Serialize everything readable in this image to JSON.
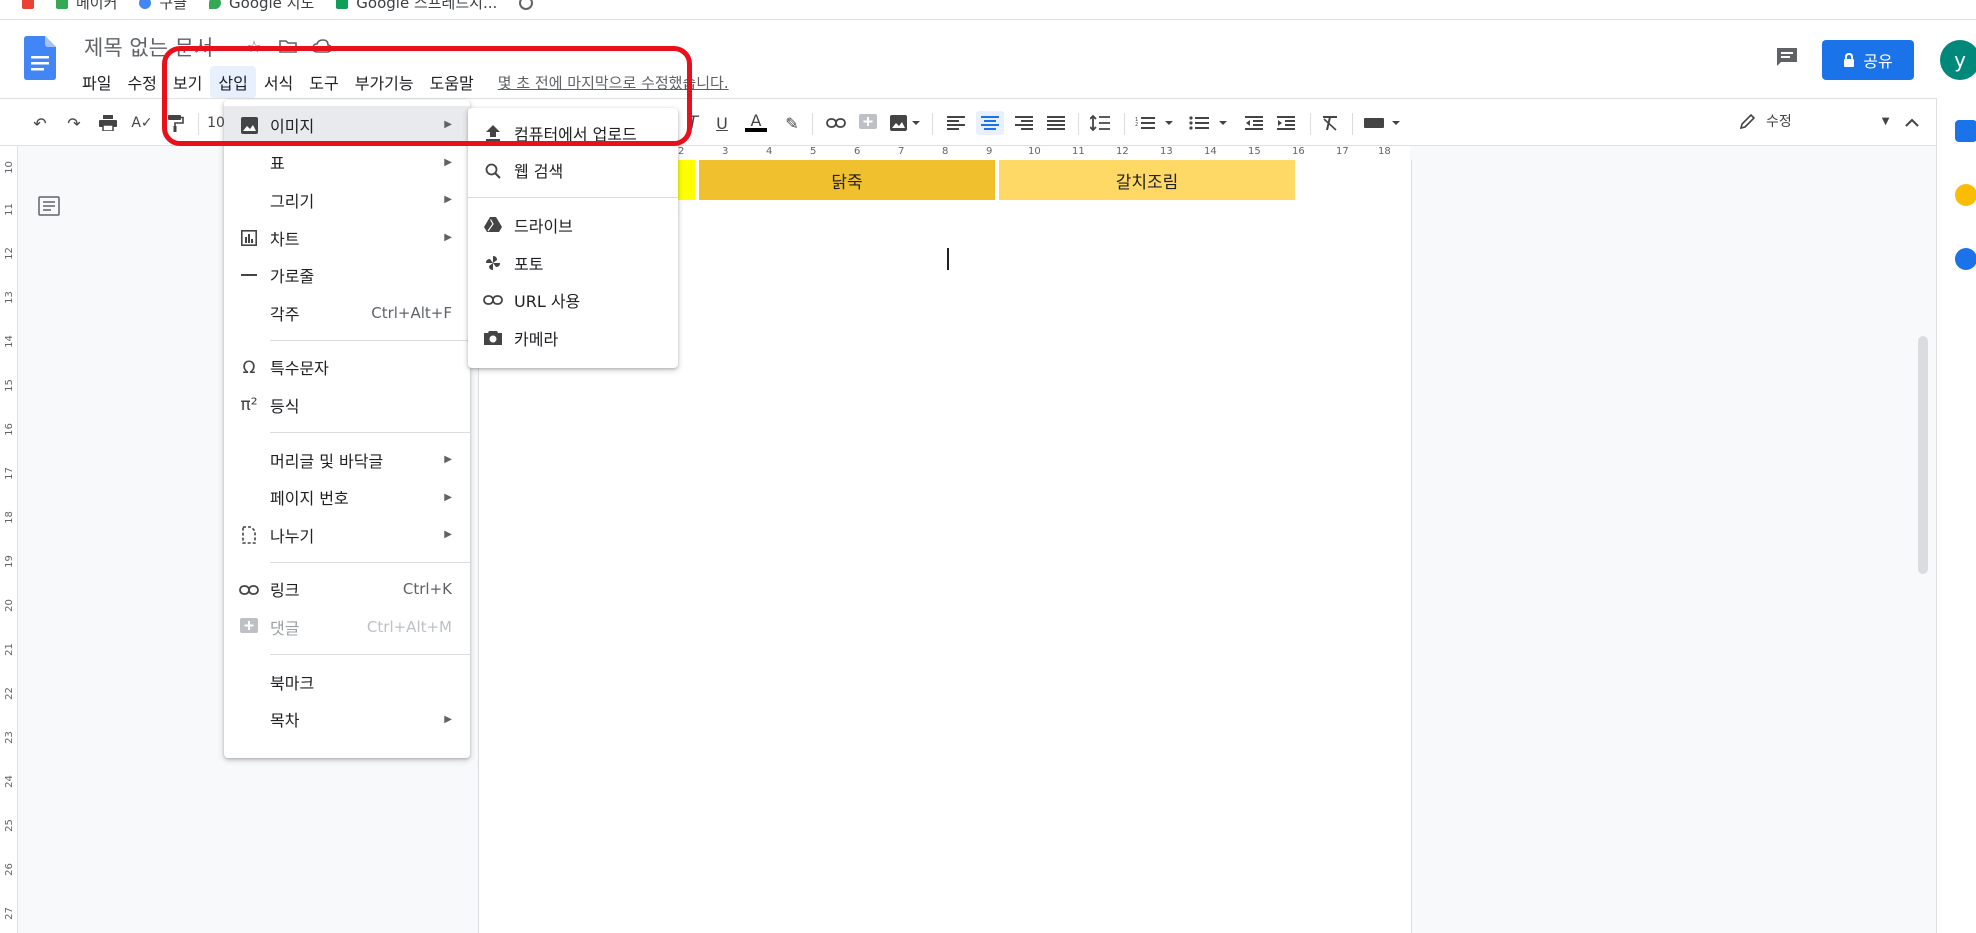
{
  "document": {
    "title": "제목 없는 문서",
    "last_edit": "몇 초 전에 마지막으로 수정했습니다."
  },
  "bookmarks": [
    {
      "label": "메이커",
      "color": "#34a853"
    },
    {
      "label": "구글",
      "color": "#4285f4"
    },
    {
      "label": "Google 지도",
      "color": "#34a853"
    },
    {
      "label": "Google 스프레드시...",
      "color": "#0f9d58"
    }
  ],
  "menubar": [
    {
      "label": "파일"
    },
    {
      "label": "수정"
    },
    {
      "label": "보기"
    },
    {
      "label": "삽입"
    },
    {
      "label": "서식"
    },
    {
      "label": "도구"
    },
    {
      "label": "부가기능"
    },
    {
      "label": "도움말"
    }
  ],
  "header": {
    "share_label": "공유",
    "avatar_initial": "y",
    "accent": "#1a73e8"
  },
  "toolbar": {
    "mode_label": "수정",
    "font_size_partial": "10"
  },
  "insert_menu": {
    "image": "이미지",
    "table": "표",
    "drawing": "그리기",
    "chart": "차트",
    "horizontal_line": "가로줄",
    "footnote": "각주",
    "footnote_shortcut": "Ctrl+Alt+F",
    "special_chars": "특수문자",
    "equation": "등식",
    "header_footer": "머리글 및 바닥글",
    "page_numbers": "페이지 번호",
    "break": "나누기",
    "link": "링크",
    "link_shortcut": "Ctrl+K",
    "comment": "댓글",
    "comment_shortcut": "Ctrl+Alt+M",
    "bookmark": "북마크",
    "toc": "목차"
  },
  "image_submenu": {
    "upload": "컴퓨터에서 업로드",
    "web_search": "웹 검색",
    "drive": "드라이브",
    "photos": "포토",
    "by_url": "URL 사용",
    "camera": "카메라"
  },
  "table_cells": [
    {
      "text": "닭죽",
      "color": "#f0c02f"
    },
    {
      "text": "갈치조림",
      "color": "#ffd966"
    }
  ],
  "hruler_numbers": [
    "2",
    "3",
    "4",
    "5",
    "6",
    "7",
    "8",
    "9",
    "10",
    "11",
    "12",
    "13",
    "14",
    "15",
    "16",
    "17",
    "18"
  ],
  "vruler_numbers": [
    "10",
    "11",
    "12",
    "13",
    "14",
    "15",
    "16",
    "17",
    "18",
    "19",
    "20",
    "21",
    "22",
    "23",
    "24",
    "25",
    "26",
    "27"
  ],
  "annotation_color": "#e8101a"
}
